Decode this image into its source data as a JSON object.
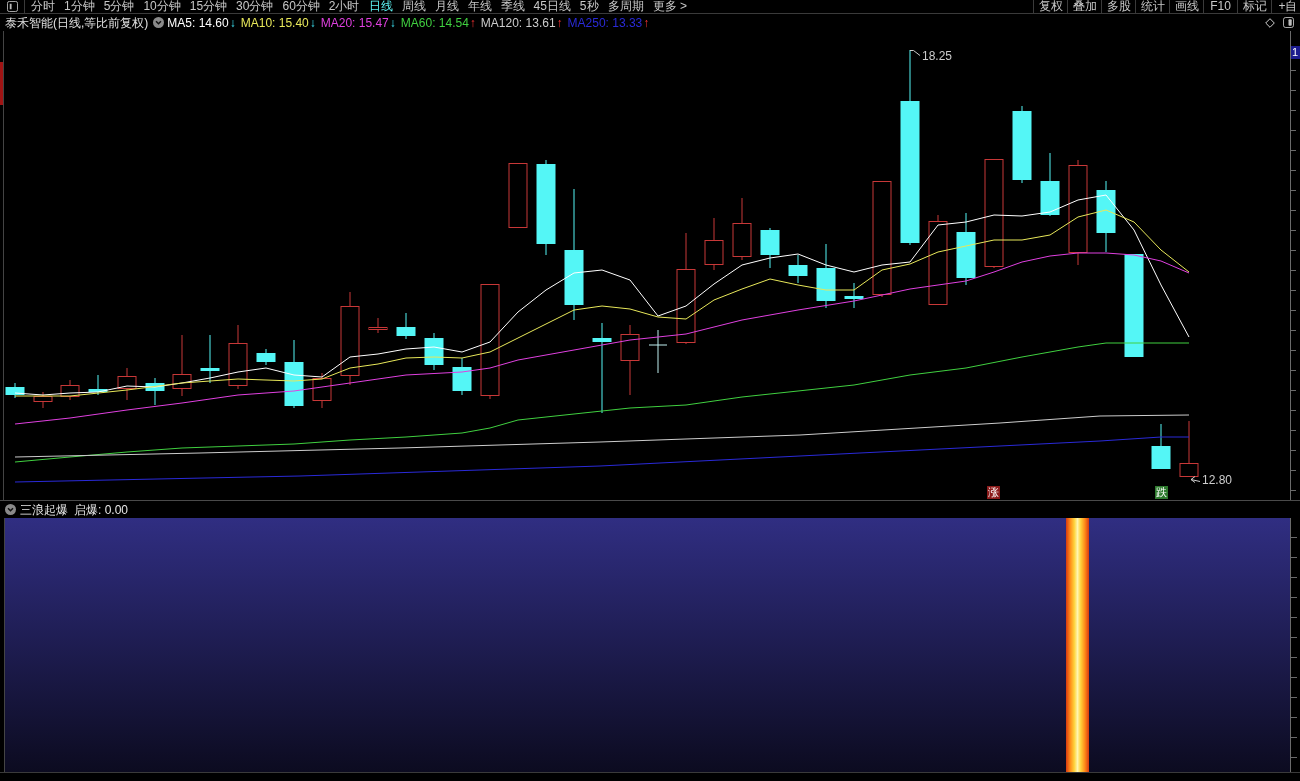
{
  "toolbar": {
    "tabs": [
      {
        "label": "分时",
        "selected": false
      },
      {
        "label": "1分钟",
        "selected": false
      },
      {
        "label": "5分钟",
        "selected": false
      },
      {
        "label": "10分钟",
        "selected": false
      },
      {
        "label": "15分钟",
        "selected": false
      },
      {
        "label": "30分钟",
        "selected": false
      },
      {
        "label": "60分钟",
        "selected": false
      },
      {
        "label": "2小时",
        "selected": false
      },
      {
        "label": "日线",
        "selected": true
      },
      {
        "label": "周线",
        "selected": false
      },
      {
        "label": "月线",
        "selected": false
      },
      {
        "label": "年线",
        "selected": false
      },
      {
        "label": "季线",
        "selected": false
      },
      {
        "label": "45日线",
        "selected": false
      },
      {
        "label": "5秒",
        "selected": false
      },
      {
        "label": "多周期",
        "selected": false
      },
      {
        "label": "更多 >",
        "selected": false
      }
    ],
    "actions": [
      "复权",
      "叠加",
      "多股",
      "统计",
      "画线",
      "F10",
      "标记",
      "+自"
    ]
  },
  "legend": {
    "title": "泰禾智能(日线,等比前复权)",
    "averages": [
      {
        "label": "MA5: 14.60",
        "arrow": "↓",
        "rising": false,
        "color": "#ffffff"
      },
      {
        "label": "MA10: 15.40",
        "arrow": "↓",
        "rising": false,
        "color": "#e8e85a"
      },
      {
        "label": "MA20: 15.47",
        "arrow": "↓",
        "rising": false,
        "color": "#e040e0"
      },
      {
        "label": "MA60: 14.54",
        "arrow": "↑",
        "rising": true,
        "color": "#40d040"
      },
      {
        "label": "MA120: 13.61",
        "arrow": "↑",
        "rising": true,
        "color": "#cccccc"
      },
      {
        "label": "MA250: 13.33",
        "arrow": "↑",
        "rising": true,
        "color": "#2a2ad8"
      }
    ]
  },
  "chart": {
    "price_tag": "1",
    "high_label": "18.25",
    "low_label": "12.80",
    "signals": [
      {
        "text": "涨",
        "kind": "rise"
      },
      {
        "text": "跌",
        "kind": "fall"
      }
    ]
  },
  "indicator": {
    "name": "三浪起爆",
    "reading": "启爆: 0.00"
  }
}
